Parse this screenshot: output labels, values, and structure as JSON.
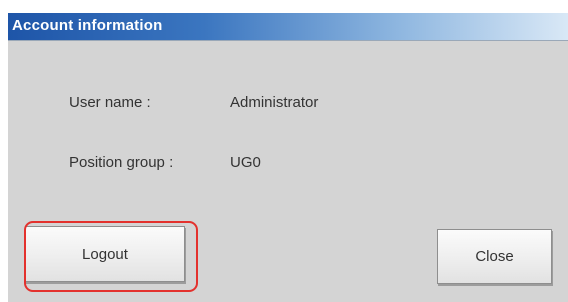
{
  "dialog": {
    "title": "Account information",
    "fields": [
      {
        "label": "User name :",
        "value": "Administrator"
      },
      {
        "label": "Position group :",
        "value": "UG0"
      }
    ]
  },
  "buttons": {
    "logout_label": "Logout",
    "close_label": "Close"
  },
  "colors": {
    "title_bar": "#1e55a8",
    "dialog_bg": "#d4d4d4",
    "highlight": "#e3312d"
  }
}
